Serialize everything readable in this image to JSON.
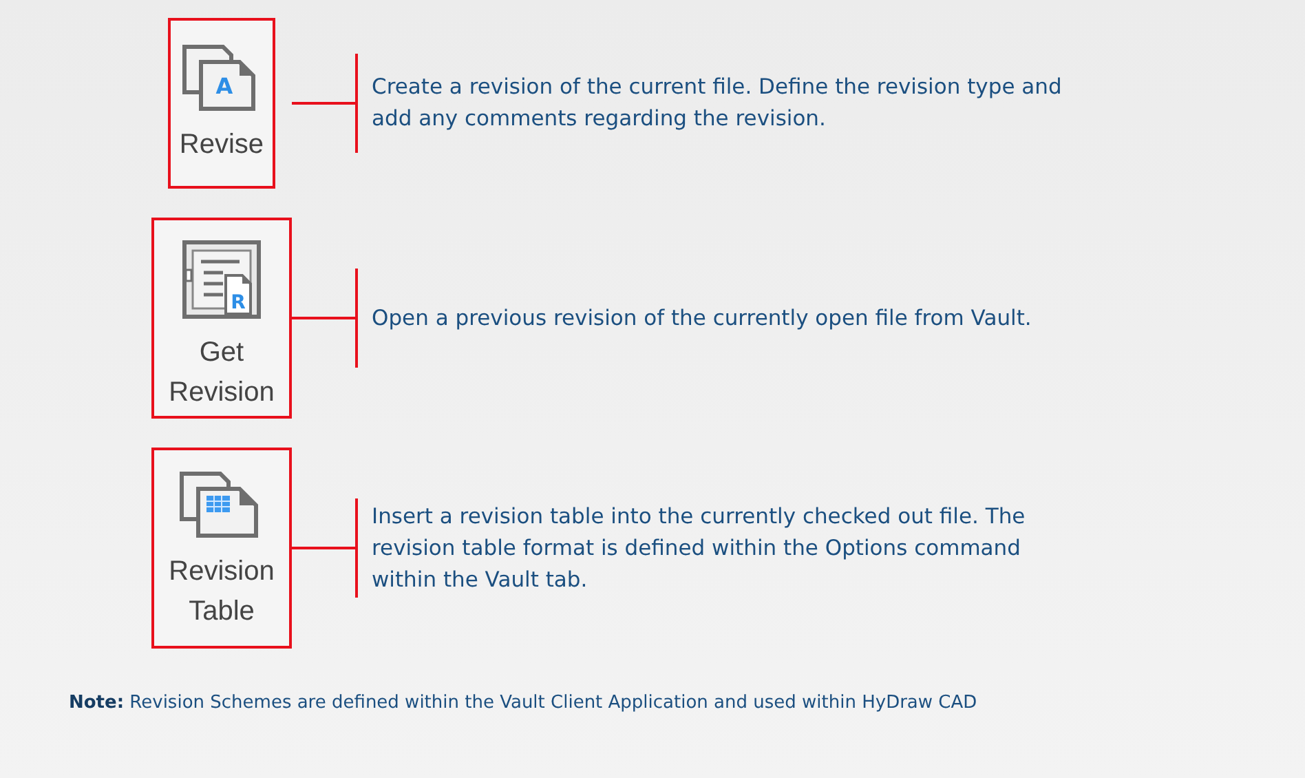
{
  "commands": [
    {
      "label": "Revise",
      "kind": "revise",
      "icon_letter": "A",
      "description": "Create a revision of the current file. Define the revision type and add any comments regarding the revision."
    },
    {
      "label": "Get Revision",
      "kind": "get",
      "icon_letter": "R",
      "description": "Open a previous revision of the currently open file from Vault."
    },
    {
      "label": "Revision Table",
      "kind": "table",
      "description": "Insert a revision table into the currently checked out file. The revision table format is defined within the Options command within the Vault tab."
    }
  ],
  "note": "**Note:** Revision Schemes are defined within the Vault Client Application and used within HyDraw CAD"
}
